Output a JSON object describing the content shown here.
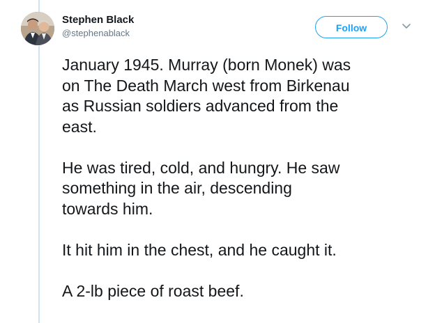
{
  "author": {
    "name": "Stephen Black",
    "handle": "@stephenablack",
    "avatar_icon": "profile-photo"
  },
  "actions": {
    "follow_label": "Follow",
    "more_icon": "chevron-down-icon"
  },
  "tweet": {
    "paragraphs": [
      "January 1945. Murray (born Monek) was\non The Death March west from Birkenau\nas Russian soldiers advanced from the\neast.",
      "He was tired, cold, and hungry. He saw\nsomething in the air, descending\ntowards him.",
      "It hit him in the chest, and he caught it.",
      "A 2-lb piece of roast beef."
    ]
  },
  "colors": {
    "accent": "#1da1f2",
    "text": "#14171a",
    "secondary_text": "#657786",
    "thread_line": "#cfe3f3"
  }
}
